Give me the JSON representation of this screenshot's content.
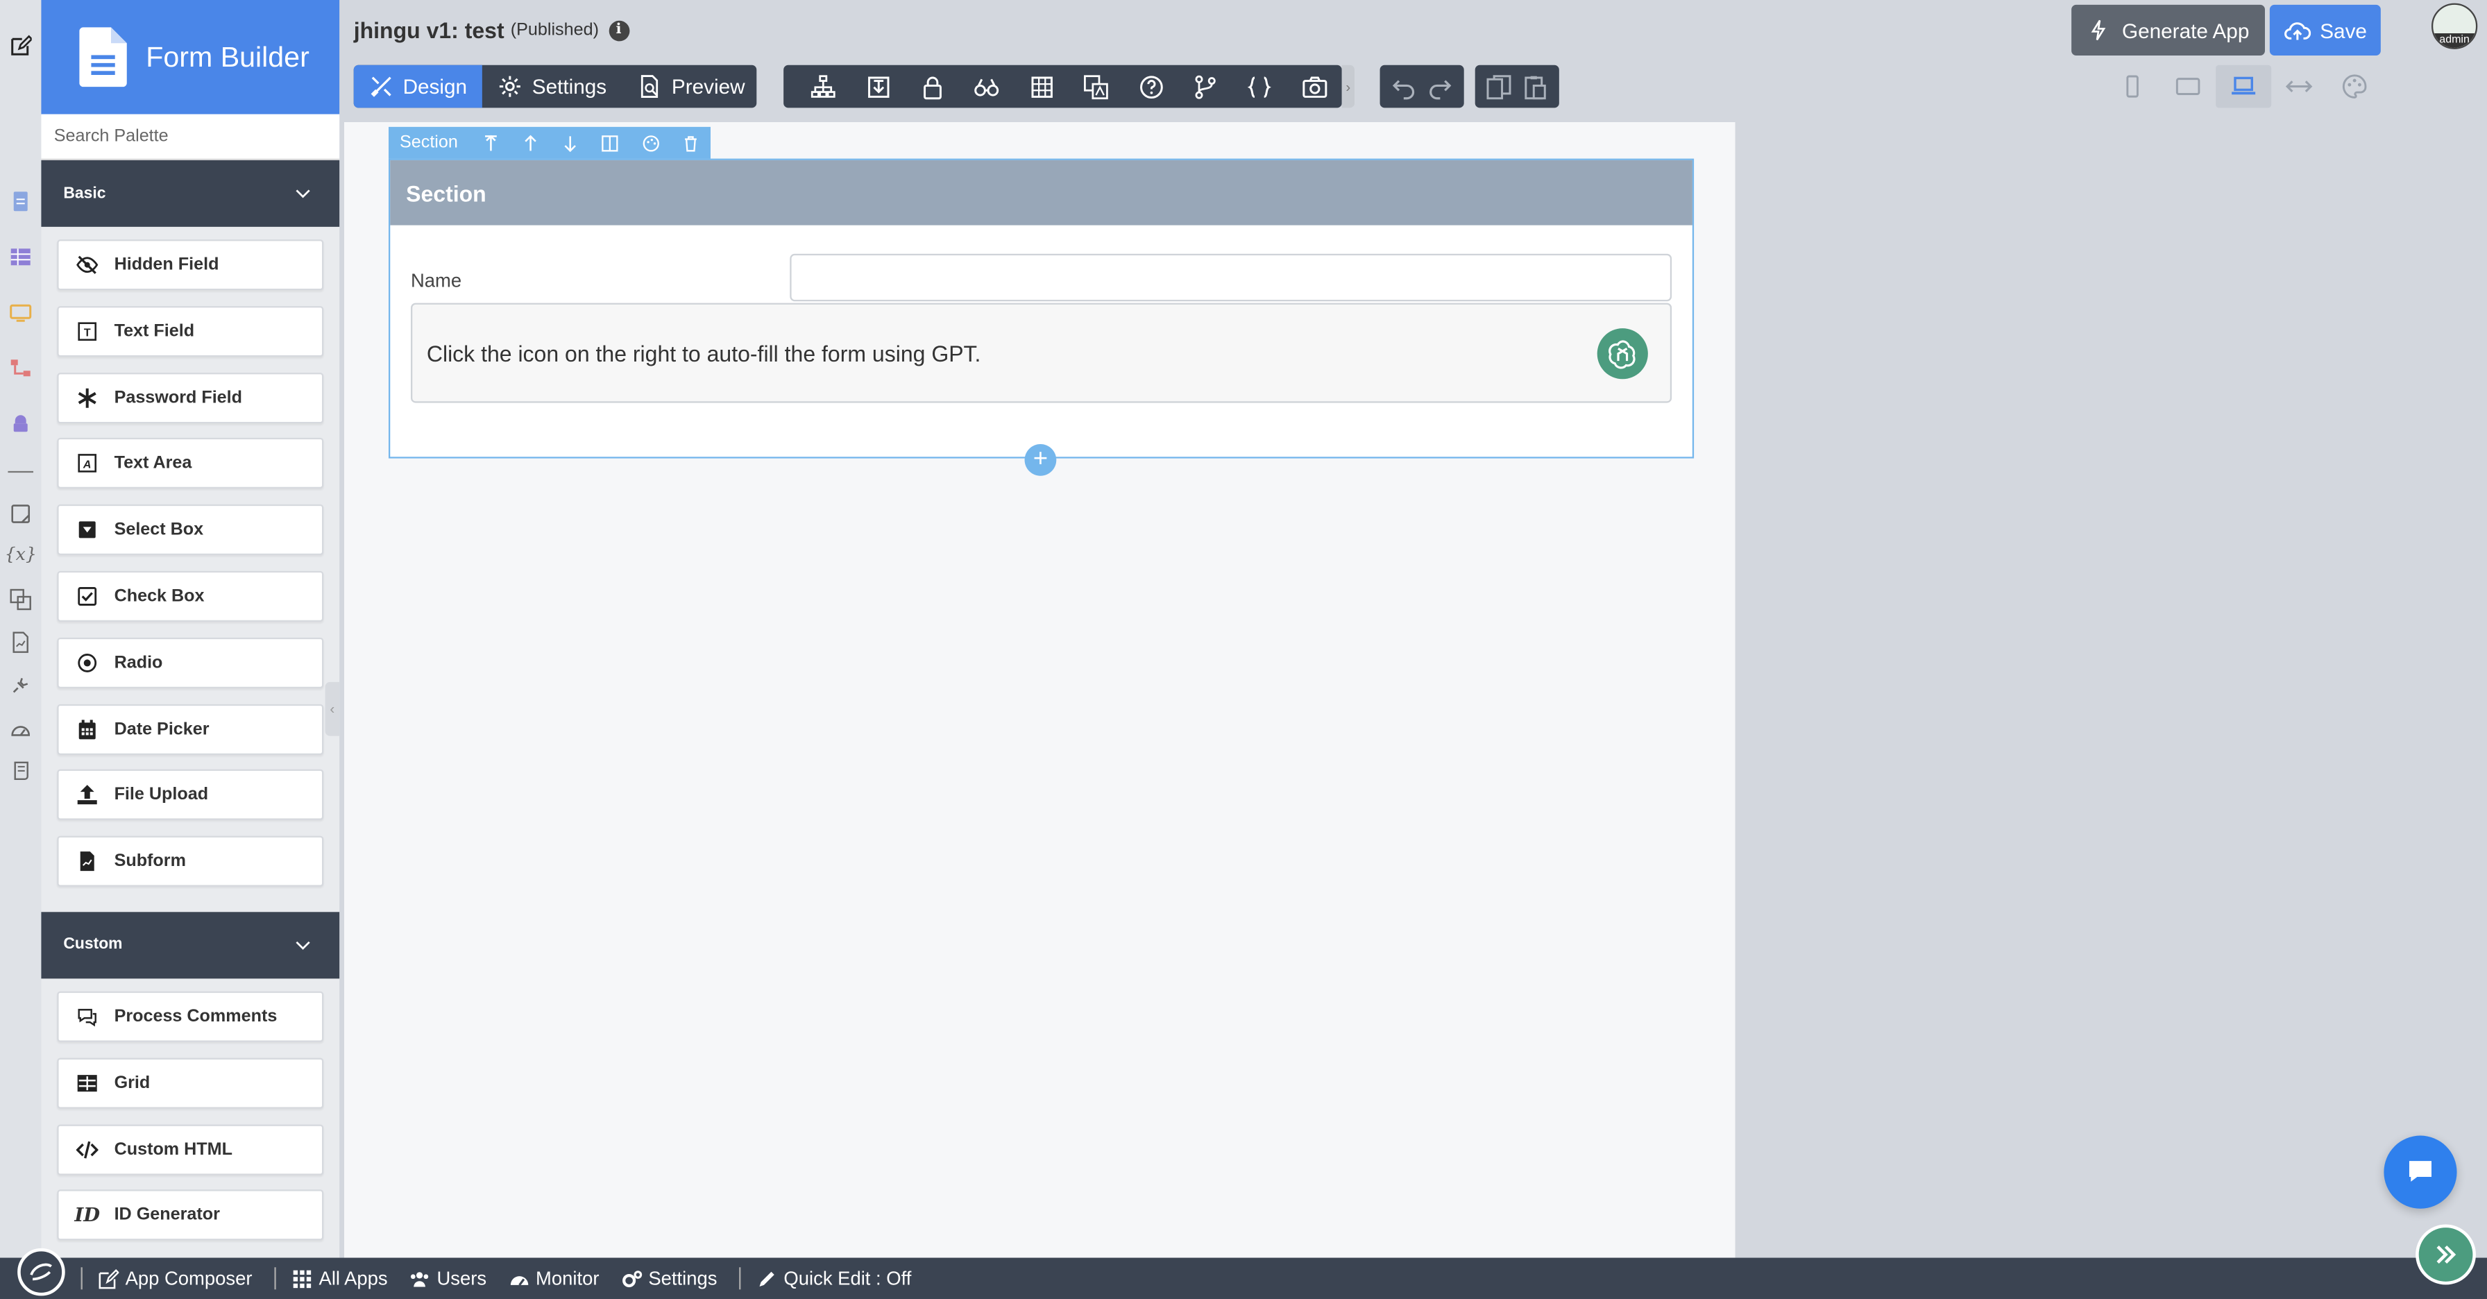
{
  "app": {
    "brand": "Form Builder",
    "title": "jhingu v1: test",
    "status": "(Published)",
    "info_icon": "i"
  },
  "search": {
    "placeholder": "Search Palette"
  },
  "palette": {
    "basic": {
      "label": "Basic",
      "items": [
        {
          "label": "Hidden Field",
          "icon": "eye-slash-icon"
        },
        {
          "label": "Text Field",
          "icon": "text-field-icon"
        },
        {
          "label": "Password Field",
          "icon": "asterisk-icon"
        },
        {
          "label": "Text Area",
          "icon": "text-area-icon"
        },
        {
          "label": "Select Box",
          "icon": "select-box-icon"
        },
        {
          "label": "Check Box",
          "icon": "checkbox-icon"
        },
        {
          "label": "Radio",
          "icon": "radio-icon"
        },
        {
          "label": "Date Picker",
          "icon": "calendar-icon"
        },
        {
          "label": "File Upload",
          "icon": "upload-icon"
        },
        {
          "label": "Subform",
          "icon": "subform-icon"
        }
      ]
    },
    "custom": {
      "label": "Custom",
      "items": [
        {
          "label": "Process Comments",
          "icon": "comments-icon"
        },
        {
          "label": "Grid",
          "icon": "grid-icon"
        },
        {
          "label": "Custom HTML",
          "icon": "code-icon"
        },
        {
          "label": "ID Generator",
          "icon": "id-icon"
        }
      ]
    }
  },
  "tabs": {
    "design": "Design",
    "settings": "Settings",
    "preview": "Preview"
  },
  "header_buttons": {
    "generate": "Generate App",
    "save": "Save"
  },
  "avatar": {
    "label": "admin"
  },
  "section_toolbar": {
    "label": "Section"
  },
  "section": {
    "title": "Section",
    "name_label": "Name",
    "name_value": "",
    "gpt_hint": "Click the icon on the right to auto-fill the form using GPT."
  },
  "footer": {
    "items": [
      {
        "label": "App Composer",
        "icon": "edit-icon"
      },
      {
        "label": "All Apps",
        "icon": "apps-grid-icon"
      },
      {
        "label": "Users",
        "icon": "users-icon"
      },
      {
        "label": "Monitor",
        "icon": "gauge-icon"
      },
      {
        "label": "Settings",
        "icon": "cogs-icon"
      },
      {
        "label": "Quick Edit : Off",
        "icon": "pencil-icon"
      }
    ]
  },
  "colors": {
    "accent": "#4a86e8",
    "dark": "#3b4452",
    "section_head": "#98a7b8",
    "gpt": "#4c9c7f"
  }
}
